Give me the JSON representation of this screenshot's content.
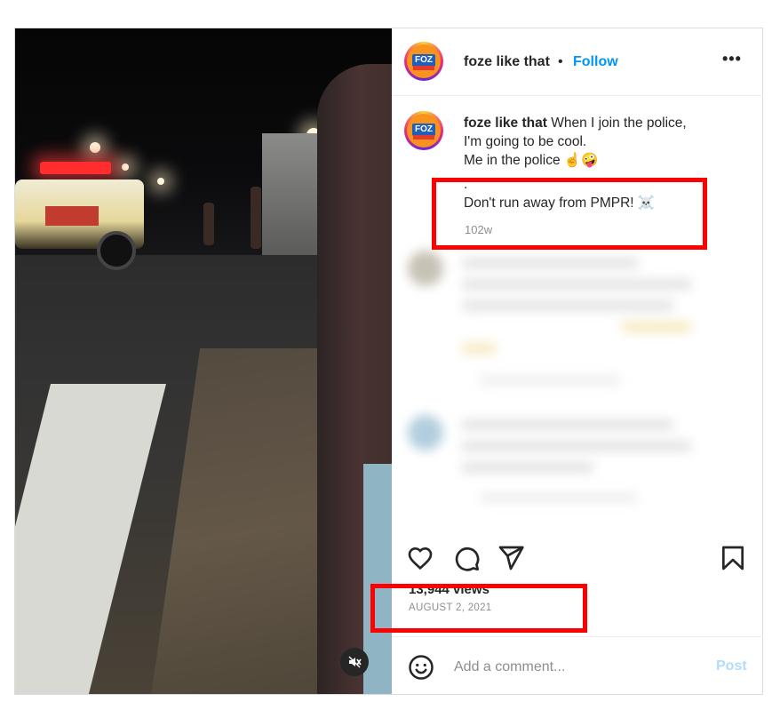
{
  "post": {
    "account": {
      "username": "foze like that",
      "avatar_text": "FOZ",
      "follow_label": "Follow",
      "separator": "•",
      "more_label": "•••"
    },
    "caption": {
      "username": "foze like that",
      "lines": [
        "When I join the police,",
        "I'm going to be cool.",
        "Me in the police ☝️🤪",
        ".",
        "Don't run away from PMPR! ☠️"
      ],
      "time_ago": "102w"
    },
    "stats": {
      "views": "13,944 views",
      "date": "AUGUST 2, 2021"
    },
    "comment_bar": {
      "placeholder": "Add a comment...",
      "post_label": "Post"
    },
    "icons": {
      "like": "heart-icon",
      "comment": "comment-icon",
      "share": "paper-plane-icon",
      "save": "bookmark-icon",
      "emoji": "smiley-icon",
      "mute": "speaker-muted-icon"
    },
    "colors": {
      "link": "#0095f6",
      "post_disabled": "#b3dbff",
      "highlight": "#ff0000",
      "secondary_text": "#8e8e8e"
    }
  }
}
